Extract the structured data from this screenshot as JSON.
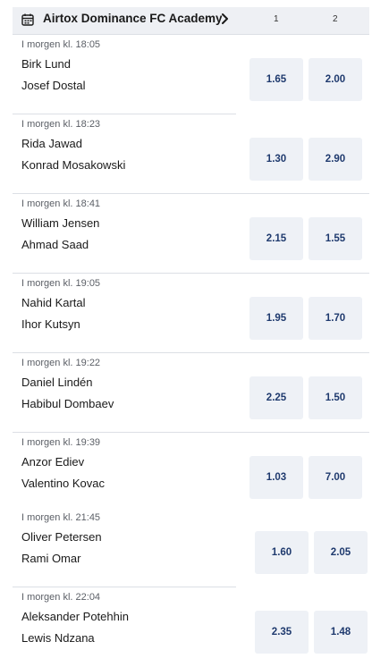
{
  "header": {
    "title": "Airtox Dominance FC Academy",
    "col1": "1",
    "col2": "2"
  },
  "matches": [
    {
      "time": "I morgen kl. 18:05",
      "player1": "Birk Lund",
      "player2": "Josef Dostal",
      "odd1": "1.65",
      "odd2": "2.00"
    },
    {
      "time": "I morgen kl. 18:23",
      "player1": "Rida Jawad",
      "player2": "Konrad Mosakowski",
      "odd1": "1.30",
      "odd2": "2.90"
    },
    {
      "time": "I morgen kl. 18:41",
      "player1": "William Jensen",
      "player2": "Ahmad Saad",
      "odd1": "2.15",
      "odd2": "1.55"
    },
    {
      "time": "I morgen kl. 19:05",
      "player1": "Nahid Kartal",
      "player2": "Ihor Kutsyn",
      "odd1": "1.95",
      "odd2": "1.70"
    },
    {
      "time": "I morgen kl. 19:22",
      "player1": "Daniel Lindén",
      "player2": "Habibul Dombaev",
      "odd1": "2.25",
      "odd2": "1.50"
    },
    {
      "time": "I morgen kl. 19:39",
      "player1": "Anzor Ediev",
      "player2": "Valentino Kovac",
      "odd1": "1.03",
      "odd2": "7.00"
    },
    {
      "time": "I morgen kl. 21:45",
      "player1": "Oliver Petersen",
      "player2": "Rami Omar",
      "odd1": "1.60",
      "odd2": "2.05"
    },
    {
      "time": "I morgen kl. 22:04",
      "player1": "Aleksander Potehhin",
      "player2": "Lewis Ndzana",
      "odd1": "2.35",
      "odd2": "1.48"
    }
  ]
}
